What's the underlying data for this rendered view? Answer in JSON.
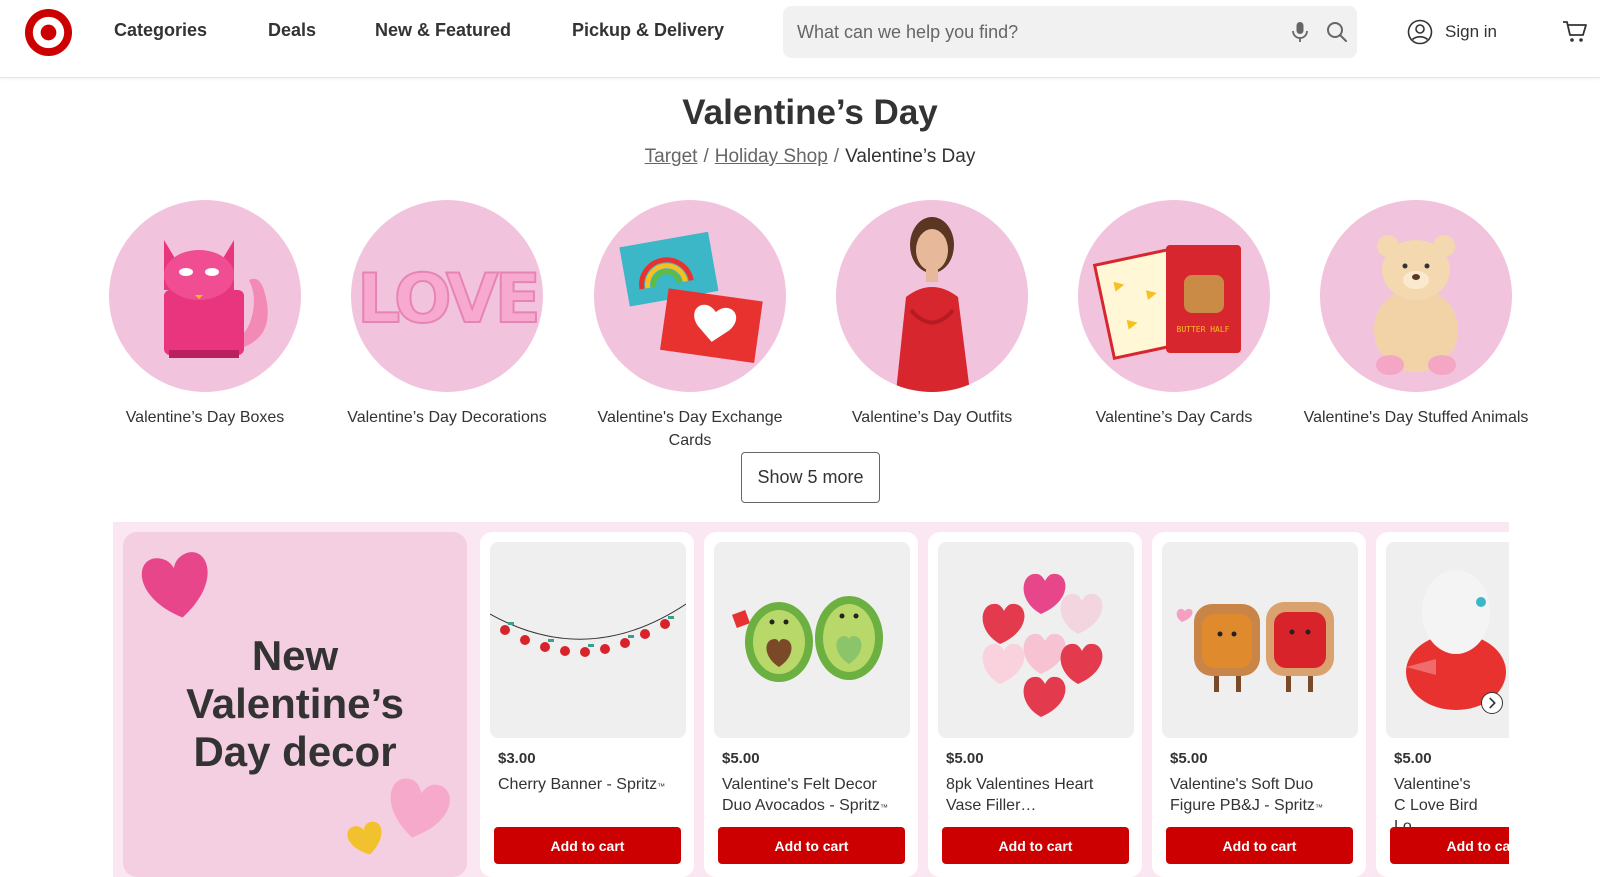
{
  "header": {
    "nav": [
      "Categories",
      "Deals",
      "New & Featured",
      "Pickup & Delivery"
    ],
    "search_placeholder": "What can we help you find?",
    "signin_label": "Sign in",
    "brand_color": "#cc0000"
  },
  "page": {
    "title": "Valentine’s Day",
    "breadcrumb": [
      "Target",
      "Holiday Shop",
      "Valentine’s Day"
    ]
  },
  "categories": [
    "Valentine’s Day Boxes",
    "Valentine’s Day Decorations",
    "Valentine's Day Exchange Cards",
    "Valentine’s Day Outfits",
    "Valentine’s Day Cards",
    "Valentine's Day Stuffed Animals"
  ],
  "show_more_label": "Show 5 more",
  "promo": {
    "line1": "New",
    "line2": "Valentine’s",
    "line3": "Day decor"
  },
  "products": [
    {
      "price": "$3.00",
      "name": "Cherry Banner - Spritz",
      "tm": "™",
      "add_label": "Add to cart"
    },
    {
      "price": "$5.00",
      "name": "Valentine's Felt Decor Duo Avocados - Spritz",
      "tm": "™",
      "add_label": "Add to cart"
    },
    {
      "price": "$5.00",
      "name": "8pk Valentines Heart Vase Filler…",
      "tm": "",
      "add_label": "Add to cart"
    },
    {
      "price": "$5.00",
      "name": "Valentine's Soft Duo Figure PB&J - Spritz",
      "tm": "™",
      "add_label": "Add to cart"
    },
    {
      "price": "$5.00",
      "name": "Valentine's C Love Bird Lo",
      "tm": "",
      "add_label": "Add to cart"
    }
  ]
}
